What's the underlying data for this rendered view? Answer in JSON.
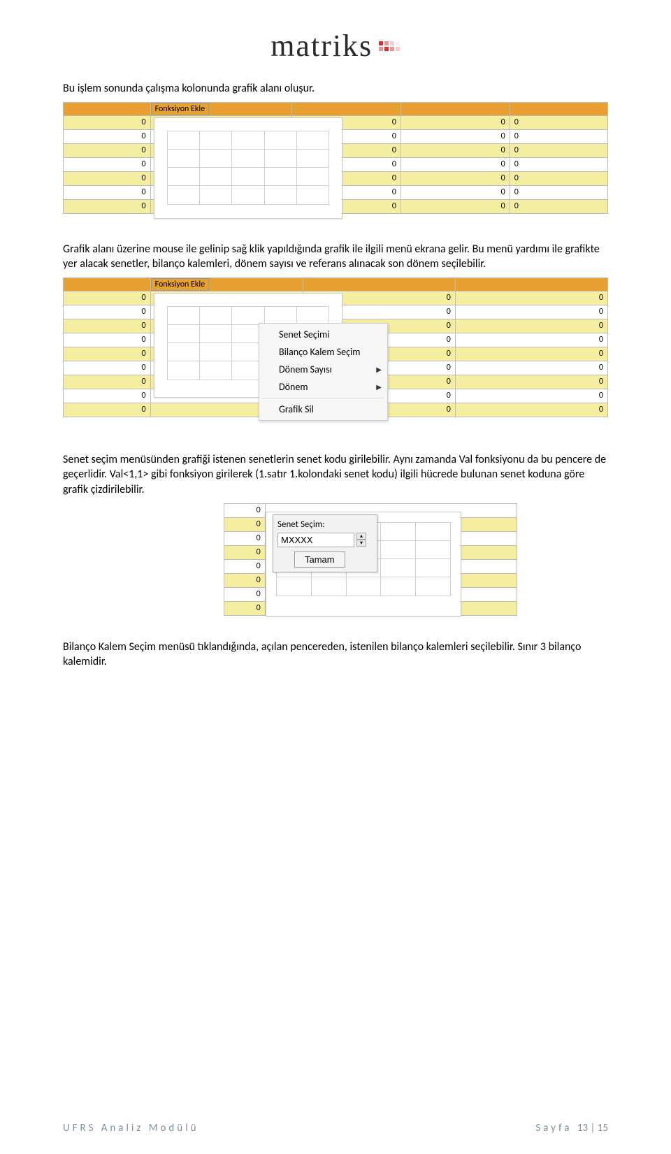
{
  "logo": {
    "text": "matriks"
  },
  "para1": "Bu işlem sonunda çalışma kolonunda grafik alanı oluşur.",
  "ss1": {
    "fx_label": "Fonksiyon Ekle",
    "row_value": "0"
  },
  "para2": "Grafik alanı üzerine mouse ile gelinip sağ klik yapıldığında grafik ile ilgili menü ekrana gelir. Bu menü yardımı ile grafikte yer alacak senetler, bilanço kalemleri, dönem sayısı ve referans alınacak son dönem seçilebilir.",
  "ss2": {
    "fx_label": "Fonksiyon Ekle",
    "row_value": "0",
    "menu": {
      "item1": "Senet Seçimi",
      "item2": "Bilanço Kalem Seçim",
      "item3": "Dönem Sayısı",
      "item4": "Dönem",
      "item5": "Grafik Sil"
    }
  },
  "para3": "Senet seçim menüsünden grafiği istenen senetlerin senet kodu girilebilir. Aynı zamanda Val fonksiyonu da bu pencere de geçerlidir. Val<1,1> gibi fonksiyon girilerek (1.satır 1.kolondaki senet kodu) ilgili hücrede bulunan senet koduna göre grafik çizdirilebilir.",
  "ss3": {
    "row_value": "0",
    "dialog": {
      "title": "Senet Seçim:",
      "value": "MXXXX",
      "button": "Tamam"
    }
  },
  "para4": "Bilanço Kalem Seçim menüsü tıklandığında, açılan pencereden, istenilen bilanço kalemleri seçilebilir. Sınır 3 bilanço kalemidir.",
  "footer": {
    "left": "UFRS Analiz Modülü",
    "right_label": "Sayfa ",
    "page_cur": "13",
    "page_sep": " | ",
    "page_total": "15"
  }
}
